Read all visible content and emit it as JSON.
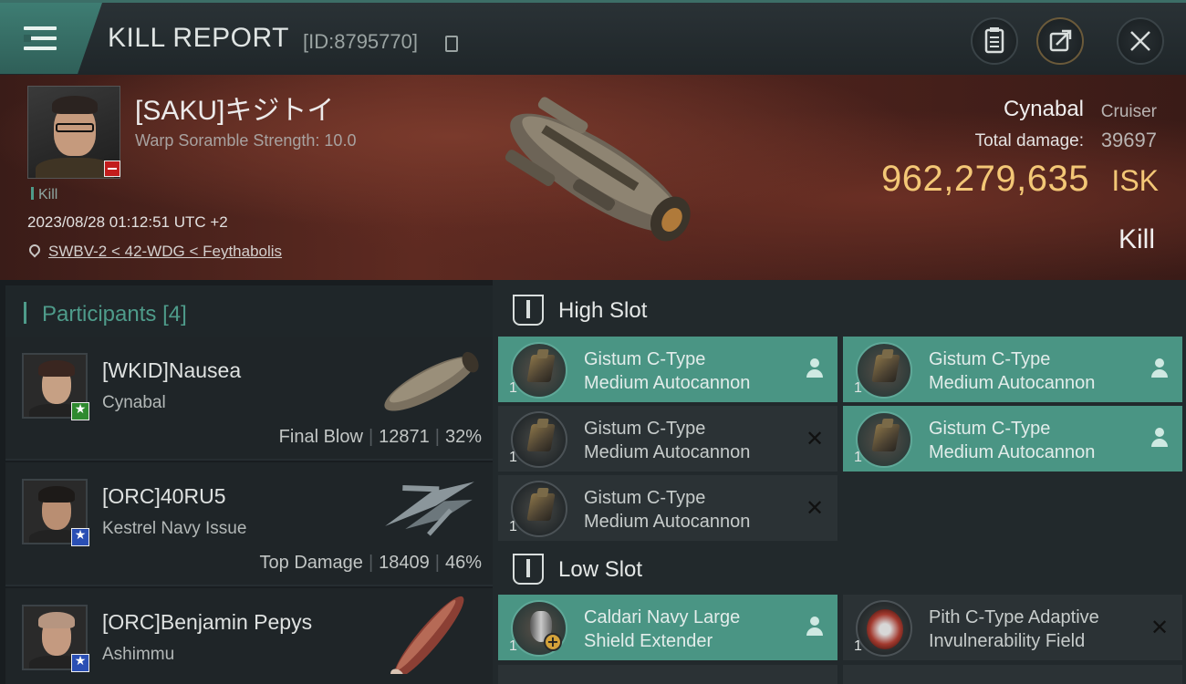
{
  "header": {
    "title": "KILL REPORT",
    "report_id": "[ID:8795770]",
    "icons": {
      "menu": "menu-icon",
      "copy": "copy-icon",
      "clipboard": "clipboard-icon",
      "share": "share-icon",
      "close": "close-icon"
    }
  },
  "victim": {
    "name": "[SAKU]キジトイ",
    "scramble": "Warp Soramble Strength: 10.0",
    "tag": "Kill",
    "timestamp": "2023/08/28 01:12:51 UTC +2",
    "location": "SWBV-2 < 42-WDG < Feythabolis",
    "ship_name": "Cynabal",
    "ship_class": "Cruiser",
    "total_damage_label": "Total damage:",
    "total_damage": "39697",
    "isk_value": "962,279,635",
    "isk_unit": "ISK",
    "result": "Kill"
  },
  "participants": {
    "title": "Participants",
    "count": "[4]",
    "rows": [
      {
        "name": "[WKID]Nausea",
        "ship": "Cynabal",
        "stat_label": "Final Blow",
        "damage": "12871",
        "percent": "32%",
        "badge": "★",
        "badge_color": "#2f8a2f",
        "hair_color": "#3a2620"
      },
      {
        "name": "[ORC]40RU5",
        "ship": "Kestrel Navy Issue",
        "stat_label": "Top Damage",
        "damage": "18409",
        "percent": "46%",
        "badge": "★",
        "badge_color": "#2a4fb4",
        "hair_color": "#1d1a18"
      },
      {
        "name": "[ORC]Benjamin Pepys",
        "ship": "Ashimmu",
        "stat_label": "",
        "damage": "",
        "percent": "",
        "badge": "★",
        "badge_color": "#2a4fb4",
        "hair_color": "#b69580"
      }
    ]
  },
  "fitting": {
    "high_slot_title": "High Slot",
    "low_slot_title": "Low Slot",
    "high": [
      {
        "qty": "1",
        "line1": "Gistum C-Type",
        "line2": "Medium Autocannon",
        "status": "dropped"
      },
      {
        "qty": "1",
        "line1": "Gistum C-Type",
        "line2": "Medium Autocannon",
        "status": "dropped"
      },
      {
        "qty": "1",
        "line1": "Gistum C-Type",
        "line2": "Medium Autocannon",
        "status": "destroyed"
      },
      {
        "qty": "1",
        "line1": "Gistum C-Type",
        "line2": "Medium Autocannon",
        "status": "dropped"
      },
      {
        "qty": "1",
        "line1": "Gistum C-Type",
        "line2": "Medium Autocannon",
        "status": "destroyed"
      }
    ],
    "low": [
      {
        "qty": "1",
        "line1": "Caldari Navy Large",
        "line2": "Shield Extender",
        "status": "dropped"
      },
      {
        "qty": "1",
        "line1": "Pith C-Type Adaptive",
        "line2": "Invulnerability Field",
        "status": "destroyed"
      }
    ]
  },
  "colors": {
    "accent": "#4e9b8a",
    "isk": "#f3c776",
    "dropped_bg": "#4a9584",
    "destroyed_bg": "#2b3235"
  }
}
